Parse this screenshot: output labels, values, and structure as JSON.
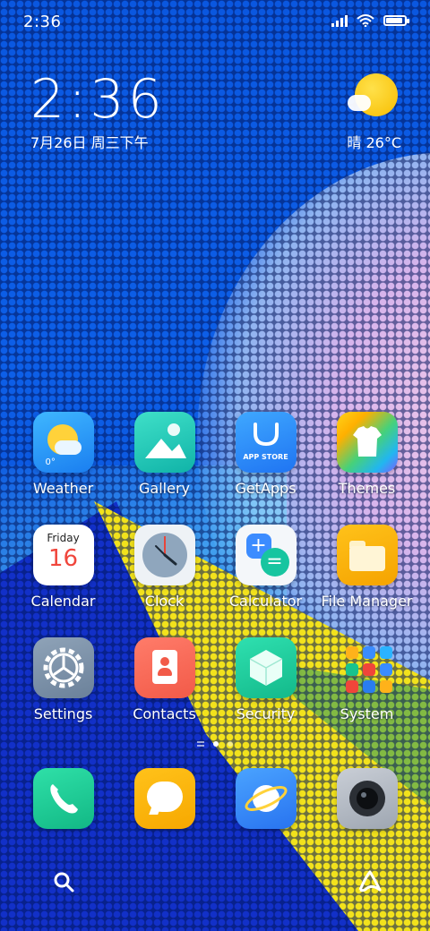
{
  "status_bar": {
    "time": "2:36",
    "battery_level": 0.9
  },
  "clock_widget": {
    "time": "2:36",
    "date": "7月26日 周三下午"
  },
  "weather_widget": {
    "text": "晴 26°C",
    "icon": "sunny-partly-cloudy-icon"
  },
  "apps": {
    "weather": {
      "label": "Weather",
      "badge": "0°"
    },
    "gallery": {
      "label": "Gallery"
    },
    "getapps": {
      "label": "GetApps",
      "tile_text": "APP STORE"
    },
    "themes": {
      "label": "Themes"
    },
    "calendar": {
      "label": "Calendar",
      "weekday": "Friday",
      "day": "16"
    },
    "clock": {
      "label": "Clock"
    },
    "calculator": {
      "label": "Calculator"
    },
    "file_manager": {
      "label": "File Manager"
    },
    "settings": {
      "label": "Settings"
    },
    "contacts": {
      "label": "Contacts"
    },
    "security": {
      "label": "Security"
    },
    "system": {
      "label": "System"
    }
  },
  "dock": {
    "phone": "phone-icon",
    "messages": "message-icon",
    "browser": "browser-icon",
    "camera": "camera-icon"
  },
  "pager": {
    "pages": 2,
    "current": 1
  },
  "colors": {
    "wallpaper_blue": "#0a57e0",
    "accent_yellow": "#f2e21c"
  }
}
